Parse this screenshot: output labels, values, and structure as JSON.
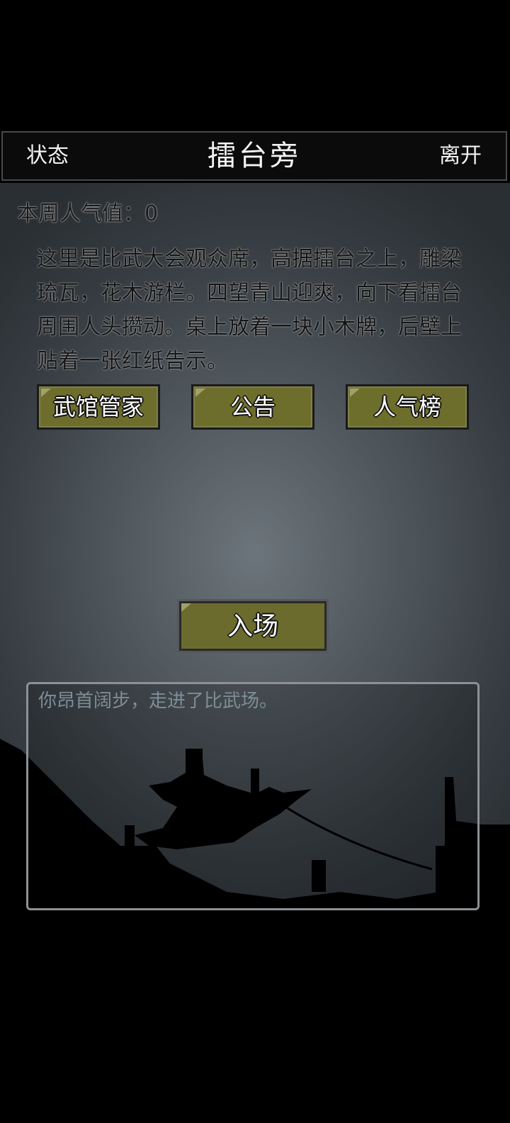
{
  "header": {
    "left_label": "状态",
    "title": "擂台旁",
    "right_label": "离开"
  },
  "popularity": {
    "label": "本周人气值：",
    "value": "0"
  },
  "description": "这里是比武大会观众席，高据擂台之上，雕梁琉瓦，花木游栏。四望青山迎爽，向下看擂台周围人头攒动。桌上放着一块小木牌，后壁上贴着一张红纸告示。",
  "actions": [
    {
      "label": "武馆管家"
    },
    {
      "label": "公告"
    },
    {
      "label": "人气榜"
    }
  ],
  "enter_button": {
    "label": "入场"
  },
  "log": {
    "text": "你昂首阔步，走进了比武场。"
  },
  "colors": {
    "button_fill": "#6e6e2c",
    "log_text": "#7f8d97",
    "bar_bg": "#0b0b0b"
  }
}
